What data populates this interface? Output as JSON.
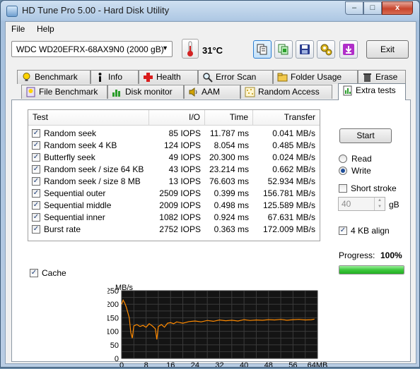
{
  "window": {
    "title": "HD Tune Pro 5.00 - Hard Disk Utility",
    "min_label": "–",
    "max_label": "□",
    "close_label": "x"
  },
  "menu": [
    {
      "label": "File",
      "mnemonic": "F"
    },
    {
      "label": "Help",
      "mnemonic": "H"
    }
  ],
  "toolbar": {
    "drive": "WDC WD20EFRX-68AX9N0 (2000 gB)",
    "temperature": "31°C",
    "icons": [
      "copy-info-icon",
      "copy-screenshot-icon",
      "save-icon",
      "options-icon",
      "download-icon"
    ],
    "exit_label": "Exit"
  },
  "tabs_row1": [
    "Benchmark",
    "Info",
    "Health",
    "Error Scan",
    "Folder Usage",
    "Erase"
  ],
  "tabs_row2": [
    "File Benchmark",
    "Disk monitor",
    "AAM",
    "Random Access",
    "Extra tests"
  ],
  "active_tab": "Extra tests",
  "table": {
    "headers": [
      "Test",
      "I/O",
      "Time",
      "Transfer"
    ],
    "rows": [
      {
        "test": "Random seek",
        "io": "85 IOPS",
        "time": "11.787 ms",
        "transfer": "0.041 MB/s",
        "checked": true
      },
      {
        "test": "Random seek 4 KB",
        "io": "124 IOPS",
        "time": "8.054 ms",
        "transfer": "0.485 MB/s",
        "checked": true
      },
      {
        "test": "Butterfly seek",
        "io": "49 IOPS",
        "time": "20.300 ms",
        "transfer": "0.024 MB/s",
        "checked": true
      },
      {
        "test": "Random seek / size 64 KB",
        "io": "43 IOPS",
        "time": "23.214 ms",
        "transfer": "0.662 MB/s",
        "checked": true
      },
      {
        "test": "Random seek / size 8 MB",
        "io": "13 IOPS",
        "time": "76.603 ms",
        "transfer": "52.934 MB/s",
        "checked": true
      },
      {
        "test": "Sequential outer",
        "io": "2509 IOPS",
        "time": "0.399 ms",
        "transfer": "156.781 MB/s",
        "checked": true
      },
      {
        "test": "Sequential middle",
        "io": "2009 IOPS",
        "time": "0.498 ms",
        "transfer": "125.589 MB/s",
        "checked": true
      },
      {
        "test": "Sequential inner",
        "io": "1082 IOPS",
        "time": "0.924 ms",
        "transfer": "67.631 MB/s",
        "checked": true
      },
      {
        "test": "Burst rate",
        "io": "2752 IOPS",
        "time": "0.363 ms",
        "transfer": "172.009 MB/s",
        "checked": true
      }
    ]
  },
  "cache": {
    "label": "Cache",
    "checked": true
  },
  "side": {
    "start_label": "Start",
    "read_label": "Read",
    "write_label": "Write",
    "selected_mode": "Write",
    "short_stroke_label": "Short stroke",
    "short_stroke_checked": false,
    "stroke_value": "40",
    "stroke_unit": "gB",
    "align_label": "4 KB align",
    "align_checked": true,
    "progress_label": "Progress:",
    "progress_value": "100%",
    "progress_fraction": 1.0
  },
  "chart_data": {
    "type": "line",
    "ylabel": "MB/s",
    "xlabel": "",
    "y_ticks": [
      "250",
      "200",
      "150",
      "100",
      "50",
      "0"
    ],
    "x_ticks": [
      "0",
      "8",
      "16",
      "24",
      "32",
      "40",
      "48",
      "56",
      "64MB"
    ],
    "xlim": [
      0,
      64
    ],
    "ylim": [
      0,
      250
    ],
    "grid": true,
    "line_color": "#ff8a00",
    "background": "#141414",
    "series": [
      {
        "x": [
          0,
          0.5,
          1,
          1.5,
          2,
          2.5,
          3,
          3.5,
          4,
          5,
          6,
          7,
          8,
          9,
          10,
          11,
          11.5,
          12,
          13,
          14,
          15,
          16,
          17,
          18,
          20,
          22,
          24,
          26,
          28,
          30,
          32,
          34,
          36,
          38,
          40,
          42,
          44,
          46,
          48,
          50,
          52,
          54,
          56,
          58,
          60,
          62,
          63
        ],
        "y": [
          200,
          215,
          205,
          190,
          170,
          150,
          95,
          75,
          120,
          125,
          118,
          122,
          115,
          128,
          120,
          110,
          70,
          118,
          125,
          115,
          130,
          132,
          128,
          135,
          130,
          136,
          138,
          135,
          140,
          137,
          142,
          139,
          141,
          138,
          143,
          140,
          142,
          141,
          143,
          142,
          144,
          141,
          143,
          144,
          142,
          143,
          145
        ]
      }
    ]
  }
}
